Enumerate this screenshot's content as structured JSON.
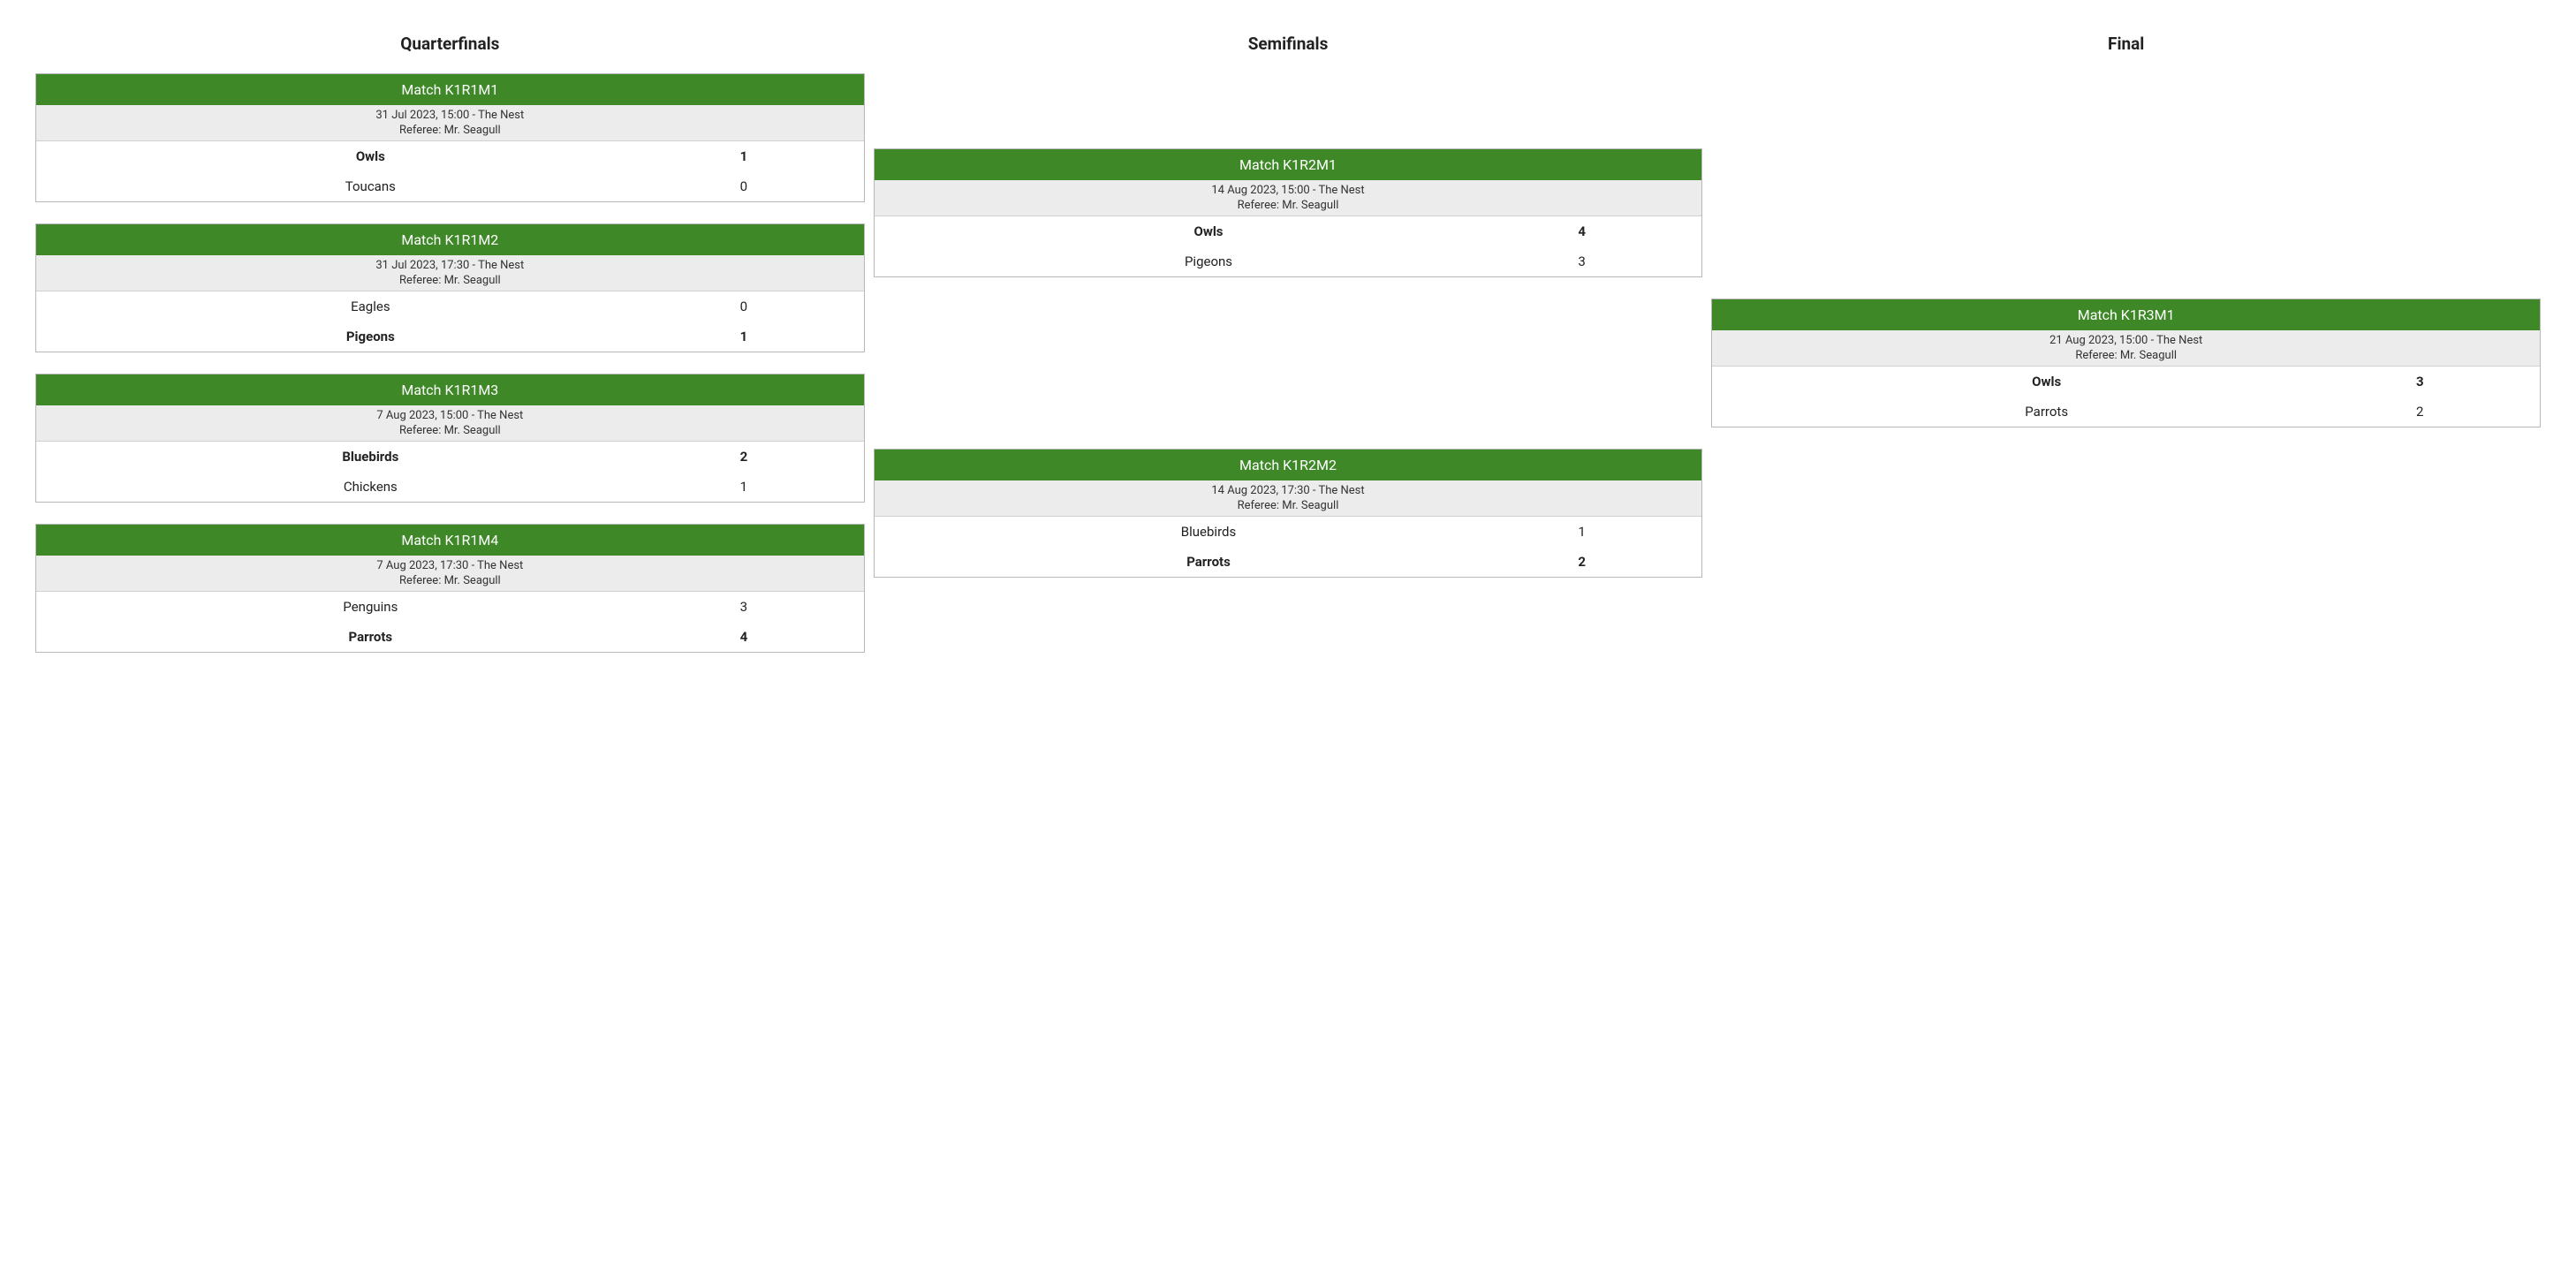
{
  "columns": [
    {
      "title": "Quarterfinals",
      "matches": [
        {
          "header": "Match K1R1M1",
          "datetime_venue": "31 Jul 2023, 15:00 - The Nest",
          "referee": "Referee: Mr. Seagull",
          "teams": [
            {
              "name": "Owls",
              "score": "1",
              "winner": true
            },
            {
              "name": "Toucans",
              "score": "0",
              "winner": false
            }
          ]
        },
        {
          "header": "Match K1R1M2",
          "datetime_venue": "31 Jul 2023, 17:30 - The Nest",
          "referee": "Referee: Mr. Seagull",
          "teams": [
            {
              "name": "Eagles",
              "score": "0",
              "winner": false
            },
            {
              "name": "Pigeons",
              "score": "1",
              "winner": true
            }
          ]
        },
        {
          "header": "Match K1R1M3",
          "datetime_venue": "7 Aug 2023, 15:00 - The Nest",
          "referee": "Referee: Mr. Seagull",
          "teams": [
            {
              "name": "Bluebirds",
              "score": "2",
              "winner": true
            },
            {
              "name": "Chickens",
              "score": "1",
              "winner": false
            }
          ]
        },
        {
          "header": "Match K1R1M4",
          "datetime_venue": "7 Aug 2023, 17:30 - The Nest",
          "referee": "Referee: Mr. Seagull",
          "teams": [
            {
              "name": "Penguins",
              "score": "3",
              "winner": false
            },
            {
              "name": "Parrots",
              "score": "4",
              "winner": true
            }
          ]
        }
      ]
    },
    {
      "title": "Semifinals",
      "matches": [
        {
          "header": "Match K1R2M1",
          "datetime_venue": "14 Aug 2023, 15:00 - The Nest",
          "referee": "Referee: Mr. Seagull",
          "teams": [
            {
              "name": "Owls",
              "score": "4",
              "winner": true
            },
            {
              "name": "Pigeons",
              "score": "3",
              "winner": false
            }
          ]
        },
        {
          "header": "Match K1R2M2",
          "datetime_venue": "14 Aug 2023, 17:30 - The Nest",
          "referee": "Referee: Mr. Seagull",
          "teams": [
            {
              "name": "Bluebirds",
              "score": "1",
              "winner": false
            },
            {
              "name": "Parrots",
              "score": "2",
              "winner": true
            }
          ]
        }
      ]
    },
    {
      "title": "Final",
      "matches": [
        {
          "header": "Match K1R3M1",
          "datetime_venue": "21 Aug 2023, 15:00 - The Nest",
          "referee": "Referee: Mr. Seagull",
          "teams": [
            {
              "name": "Owls",
              "score": "3",
              "winner": true
            },
            {
              "name": "Parrots",
              "score": "2",
              "winner": false
            }
          ]
        }
      ]
    }
  ]
}
